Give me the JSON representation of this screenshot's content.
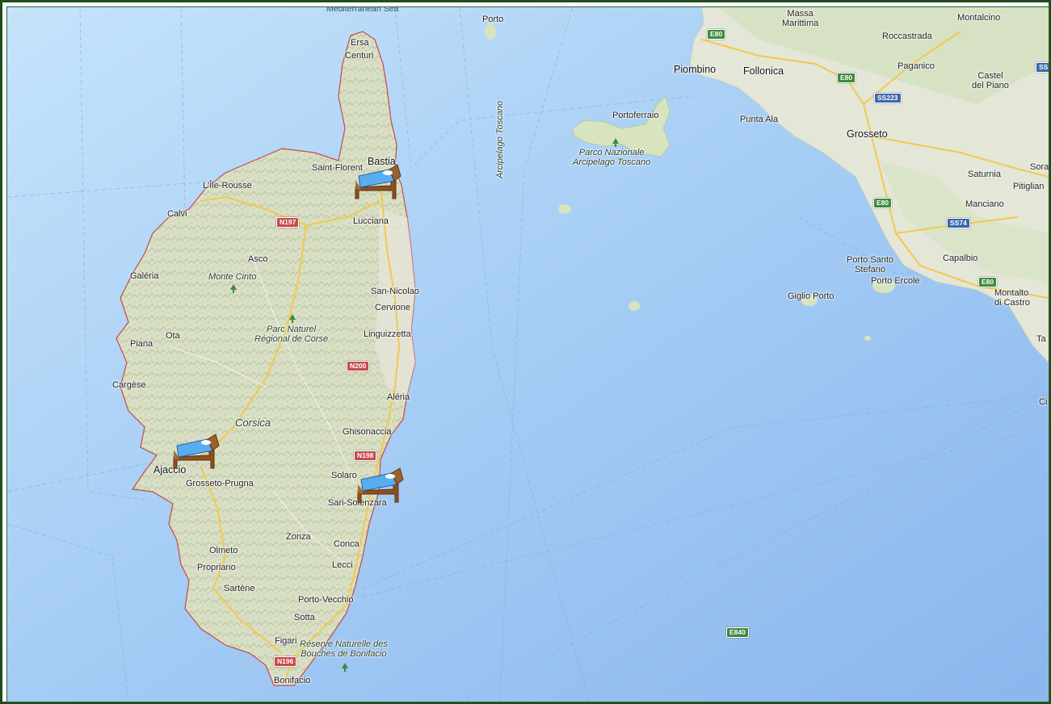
{
  "map": {
    "colors": {
      "sea": "#a8cff5",
      "land": "#dfe5cf",
      "border": "#c44a4a",
      "road_major": "#f2c94c",
      "shield_red": "#c84a4a",
      "shield_green": "#3d8a3d",
      "shield_blue": "#3a66b0",
      "frame": "#1f4d1f"
    },
    "places": {
      "bastia": "Bastia",
      "saint_florent": "Saint-Florent",
      "ersa": "Ersa",
      "centuri": "Centuri",
      "ile_rousse": "L'Île-Rousse",
      "calvi": "Calvi",
      "lucciana": "Lucciana",
      "asco": "Asco",
      "monte_cinto": "Monte Cinto",
      "galeria": "Galéria",
      "parc_corse": "Parc Naturel\nRégional de Corse",
      "san_nicolao": "San-Nicolao",
      "cervione": "Cervione",
      "linguizzetta": "Linguizzetta",
      "ota": "Ota",
      "piana": "Piana",
      "cargese": "Cargèse",
      "aleria": "Aléria",
      "corsica": "Corsica",
      "ghisonaccia": "Ghisonaccia",
      "ajaccio": "Ajaccio",
      "grosseto_prugna": "Grosseto-Prugna",
      "solaro": "Solaro",
      "sari_solenzara": "Sari-Solenzara",
      "zonza": "Zonza",
      "conca": "Conca",
      "olmeto": "Olmeto",
      "propriano": "Propriano",
      "lecci": "Lecci",
      "sartene": "Sartène",
      "porto_vecchio": "Porto-Vecchio",
      "sotta": "Sotta",
      "figari": "Figari",
      "reserve": "Réserve Naturelle des\nBouches de Bonifacio",
      "bonifacio": "Bonifacio",
      "porto": "Porto",
      "mediterranean": "Mediterranean Sea",
      "arcipelago": "Arcipelago Toscano",
      "portoferraio": "Portoferraio",
      "parco_nazionale": "Parco Nazionale\nArcipelago Toscano",
      "piombino": "Piombino",
      "follonica": "Follonica",
      "massa_marittima": "Massa\nMarittima",
      "roccastrada": "Roccastrada",
      "montalcino": "Montalcino",
      "paganico": "Paganico",
      "castel_del_piano": "Castel\ndel Piano",
      "punta_ala": "Punta Ala",
      "grosseto": "Grosseto",
      "saturnia": "Saturnia",
      "sora": "Sora",
      "pitigliano": "Pitiglian",
      "manciano": "Manciano",
      "porto_santo_stefano": "Porto Santo\nStefano",
      "porto_ercole": "Porto Ercole",
      "capalbio": "Capalbio",
      "montalto": "Montalto\ndi Castro",
      "giglio_porto": "Giglio Porto",
      "ta": "Ta",
      "ci": "Ci"
    },
    "shields": {
      "n197": "N197",
      "n200": "N200",
      "n198": "N198",
      "n196": "N196",
      "e80_a": "E80",
      "e80_b": "E80",
      "e80_c": "E80",
      "e80_d": "E80",
      "e840": "E840",
      "ss223": "SS223",
      "ss74": "SS74",
      "ss_top": "SS"
    },
    "markers": [
      {
        "name": "Bastia",
        "icon": "bed-icon"
      },
      {
        "name": "Ajaccio",
        "icon": "bed-icon"
      },
      {
        "name": "Sari-Solenzara",
        "icon": "bed-icon"
      }
    ]
  }
}
